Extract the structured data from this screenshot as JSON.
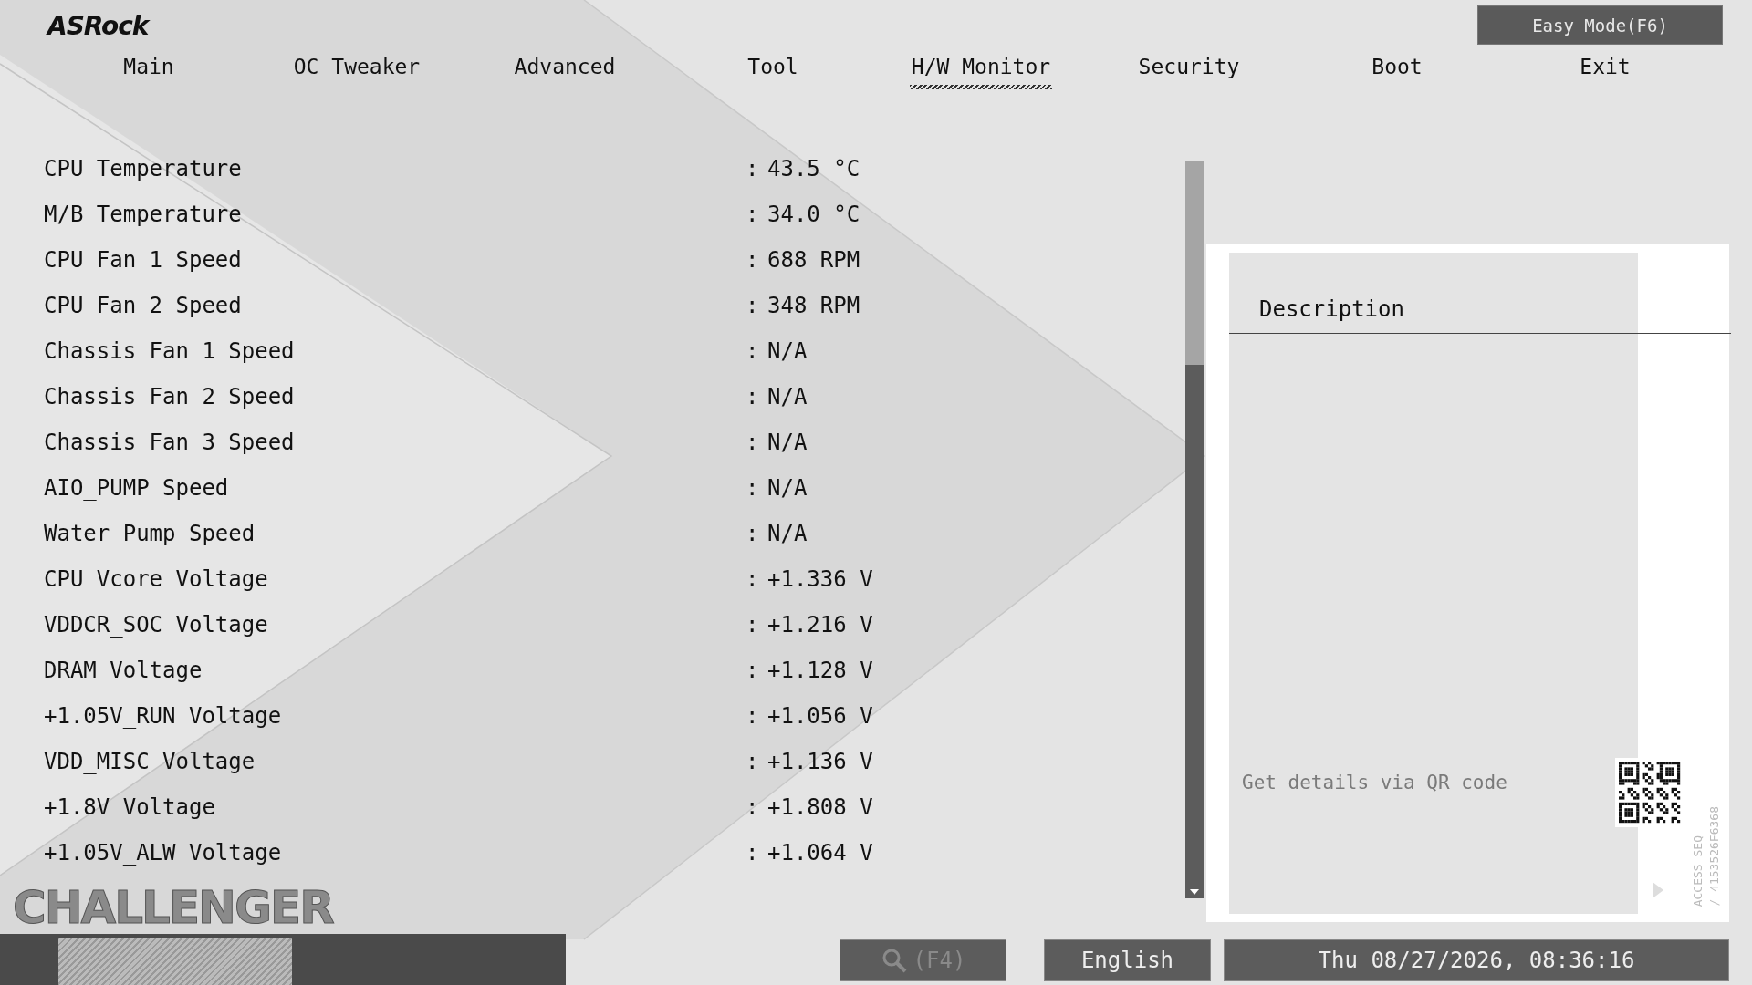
{
  "brand": "ASRock",
  "easy_mode_button": "Easy Mode(F6)",
  "tabs": [
    {
      "label": "Main",
      "selected": false
    },
    {
      "label": "OC Tweaker",
      "selected": false
    },
    {
      "label": "Advanced",
      "selected": false
    },
    {
      "label": "Tool",
      "selected": false
    },
    {
      "label": "H/W Monitor",
      "selected": true
    },
    {
      "label": "Security",
      "selected": false
    },
    {
      "label": "Boot",
      "selected": false
    },
    {
      "label": "Exit",
      "selected": false
    }
  ],
  "readings": [
    {
      "label": "CPU Temperature",
      "value": "43.5 °C"
    },
    {
      "label": "M/B Temperature",
      "value": "34.0 °C"
    },
    {
      "label": "CPU Fan 1 Speed",
      "value": "688 RPM"
    },
    {
      "label": "CPU Fan 2 Speed",
      "value": "348 RPM"
    },
    {
      "label": "Chassis Fan 1 Speed",
      "value": "N/A"
    },
    {
      "label": "Chassis Fan 2 Speed",
      "value": "N/A"
    },
    {
      "label": "Chassis Fan 3 Speed",
      "value": "N/A"
    },
    {
      "label": "AIO_PUMP Speed",
      "value": "N/A"
    },
    {
      "label": "Water Pump Speed",
      "value": "N/A"
    },
    {
      "label": "CPU Vcore Voltage",
      "value": "+1.336 V"
    },
    {
      "label": "VDDCR_SOC Voltage",
      "value": "+1.216 V"
    },
    {
      "label": "DRAM Voltage",
      "value": "+1.128 V"
    },
    {
      "label": "+1.05V_RUN Voltage",
      "value": "+1.056 V"
    },
    {
      "label": "VDD_MISC Voltage",
      "value": "+1.136 V"
    },
    {
      "label": "+1.8V Voltage",
      "value": "+1.808 V"
    },
    {
      "label": "+1.05V_ALW Voltage",
      "value": "+1.064 V"
    }
  ],
  "separator": ":",
  "description": {
    "title": "Description",
    "qr_hint": "Get details via QR code",
    "access_seq": "ACCESS SEQ",
    "access_code": "/ 4153526F6368"
  },
  "series_logo": "CHALLENGER",
  "footer": {
    "search_key": "(F4)",
    "language": "English",
    "datetime": "Thu 08/27/2026, 08:36:16"
  }
}
